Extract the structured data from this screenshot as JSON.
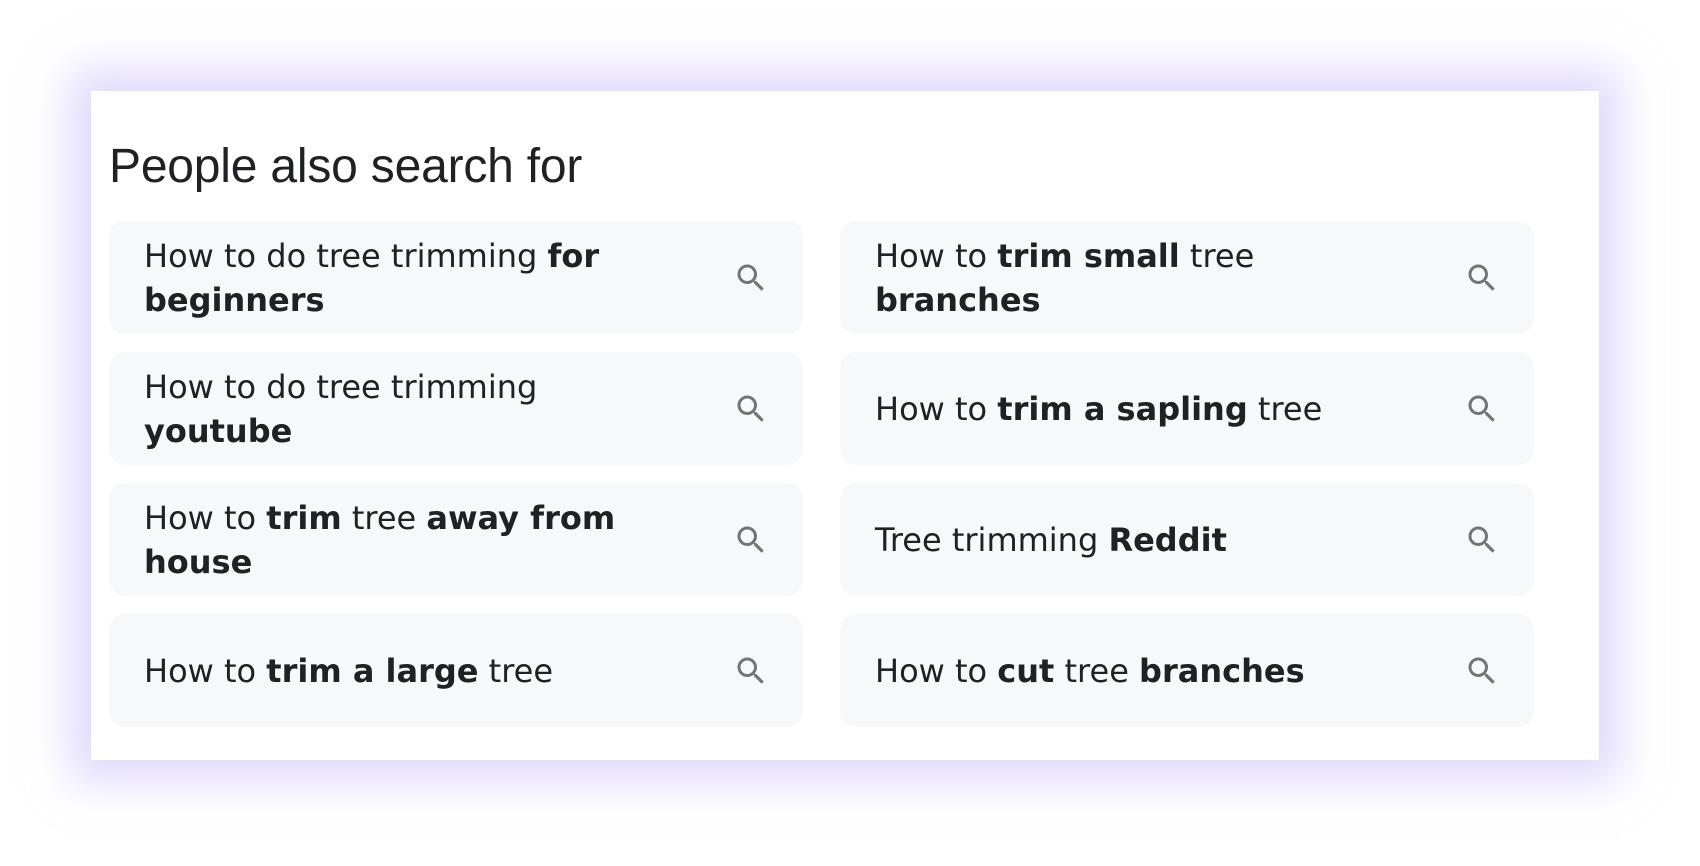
{
  "panel": {
    "title": "People also search for"
  },
  "colors": {
    "chip_background": "#f7f8fa",
    "text": "#202124",
    "icon": "#70757a",
    "panel_glow": "#c8bcfa"
  },
  "suggestions": [
    {
      "icon": "search-icon",
      "parts": [
        {
          "text": "How to do tree trimming ",
          "bold": false
        },
        {
          "text": "for beginners",
          "bold": true
        }
      ]
    },
    {
      "icon": "search-icon",
      "parts": [
        {
          "text": "How to ",
          "bold": false
        },
        {
          "text": "trim small",
          "bold": true
        },
        {
          "text": " tree ",
          "bold": false
        },
        {
          "text": "branches",
          "bold": true
        }
      ]
    },
    {
      "icon": "search-icon",
      "parts": [
        {
          "text": "How to do tree trimming ",
          "bold": false
        },
        {
          "text": "youtube",
          "bold": true
        }
      ]
    },
    {
      "icon": "search-icon",
      "parts": [
        {
          "text": "How to ",
          "bold": false
        },
        {
          "text": "trim a sapling",
          "bold": true
        },
        {
          "text": " tree",
          "bold": false
        }
      ]
    },
    {
      "icon": "search-icon",
      "parts": [
        {
          "text": "How to ",
          "bold": false
        },
        {
          "text": "trim",
          "bold": true
        },
        {
          "text": " tree ",
          "bold": false
        },
        {
          "text": "away from house",
          "bold": true
        }
      ]
    },
    {
      "icon": "search-icon",
      "parts": [
        {
          "text": "Tree trimming ",
          "bold": false
        },
        {
          "text": "Reddit",
          "bold": true
        }
      ]
    },
    {
      "icon": "search-icon",
      "parts": [
        {
          "text": "How to ",
          "bold": false
        },
        {
          "text": "trim a large",
          "bold": true
        },
        {
          "text": " tree",
          "bold": false
        }
      ]
    },
    {
      "icon": "search-icon",
      "parts": [
        {
          "text": "How to ",
          "bold": false
        },
        {
          "text": "cut",
          "bold": true
        },
        {
          "text": " tree ",
          "bold": false
        },
        {
          "text": "branches",
          "bold": true
        }
      ]
    }
  ]
}
